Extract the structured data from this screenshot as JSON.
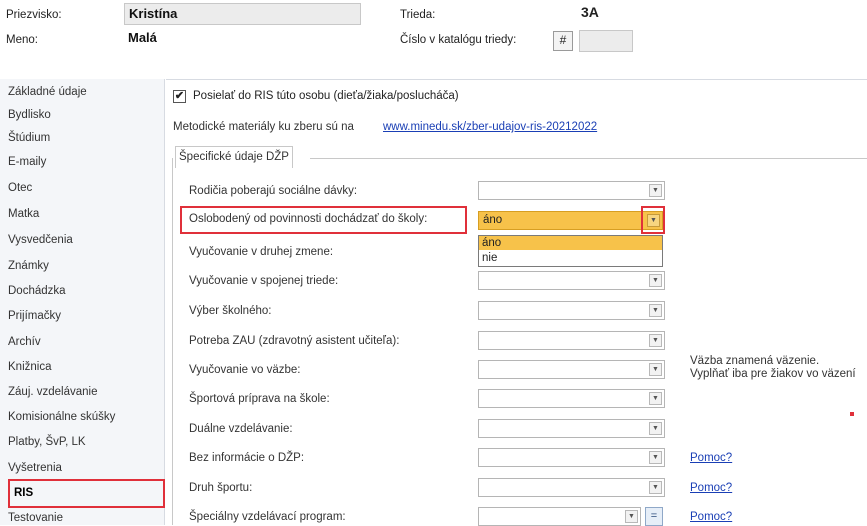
{
  "header": {
    "surname_label": "Priezvisko:",
    "surname_value": "Kristína",
    "firstname_label": "Meno:",
    "firstname_value": "Malá",
    "class_label": "Trieda:",
    "class_value": "3A",
    "catalog_label": "Číslo v katalógu triedy:",
    "hash_button": "#"
  },
  "sidebar": {
    "items": [
      {
        "label": "Základné údaje"
      },
      {
        "label": "Bydlisko"
      },
      {
        "label": "Štúdium"
      },
      {
        "label": "E-maily"
      },
      {
        "label": "Otec"
      },
      {
        "label": "Matka"
      },
      {
        "label": "Vysvedčenia"
      },
      {
        "label": "Známky"
      },
      {
        "label": "Dochádzka"
      },
      {
        "label": "Prijímačky"
      },
      {
        "label": "Archív"
      },
      {
        "label": "Knižnica"
      },
      {
        "label": "Záuj. vzdelávanie"
      },
      {
        "label": "Komisionálne skúšky"
      },
      {
        "label": "Platby, ŠvP, LK"
      },
      {
        "label": "Vyšetrenia"
      },
      {
        "label": "RIS"
      },
      {
        "label": "Testovanie"
      }
    ],
    "active": "RIS"
  },
  "main": {
    "send_checkbox_label": "Posielať do RIS túto osobu (dieťa/žiaka/poslucháča)",
    "send_checked": true,
    "materials_text": "Metodické materiály ku zberu sú na",
    "materials_link": "www.minedu.sk/zber-udajov-ris-20212022",
    "section_title": "Špecifické údaje DŽP",
    "rows": [
      {
        "label": "Rodičia poberajú sociálne dávky:",
        "value": ""
      },
      {
        "label": "Oslobodený od povinnosti dochádzať do školy:",
        "value": "áno"
      },
      {
        "label": "Vyučovanie v druhej zmene:",
        "value": ""
      },
      {
        "label": "Vyučovanie v spojenej triede:",
        "value": ""
      },
      {
        "label": "Výber školného:",
        "value": ""
      },
      {
        "label": "Potreba ZAU (zdravotný asistent učiteľa):",
        "value": ""
      },
      {
        "label": "Vyučovanie vo väzbe:",
        "value": ""
      },
      {
        "label": "Športová príprava na škole:",
        "value": ""
      },
      {
        "label": "Duálne vzdelávanie:",
        "value": ""
      },
      {
        "label": "Bez informácie o DŽP:",
        "value": ""
      },
      {
        "label": "Druh športu:",
        "value": ""
      },
      {
        "label": "Špeciálny vzdelávací program:",
        "value": ""
      }
    ],
    "dropdown_options": [
      "áno",
      "nie"
    ],
    "dropdown_selected": "áno",
    "note_line1": "Väzba znamená väzenie.",
    "note_line2": "Vyplňať iba pre žiakov vo väzení",
    "help_link": "Pomoc?",
    "eq_button": "="
  },
  "colors": {
    "highlight_red": "#e0303a",
    "selected_orange": "#f7c24a",
    "link_blue": "#1a3fb5"
  }
}
